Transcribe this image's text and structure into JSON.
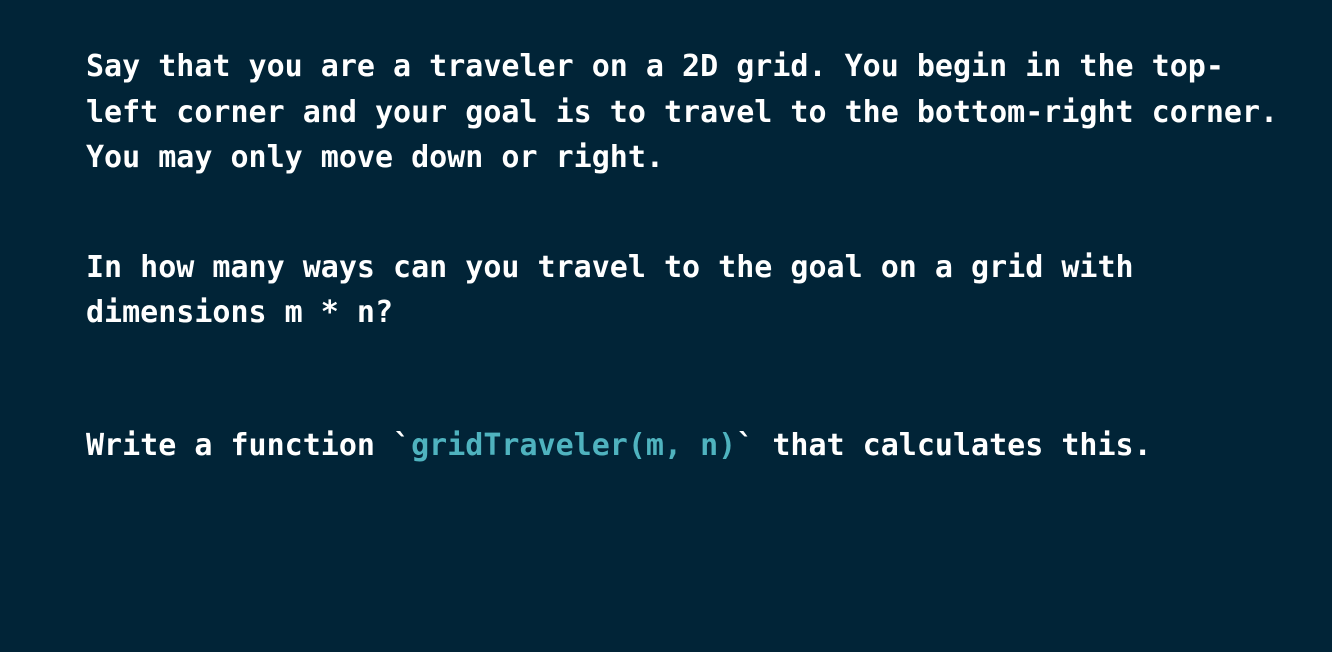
{
  "content": {
    "paragraph1": "Say that you are a traveler on a 2D grid. You begin in the top-left corner and your goal is to travel to the bottom-right corner. You may only move down or right.",
    "paragraph2": "In how many ways can you travel to the goal on a grid with dimensions m * n?",
    "paragraph3": {
      "prefix": "Write a function ",
      "backtick_open": "`",
      "code": "gridTraveler(m, n)",
      "backtick_close": "`",
      "suffix": " that calculates this."
    }
  },
  "colors": {
    "background": "#012437",
    "text": "#ffffff",
    "code_highlight": "#4fb3bf"
  }
}
